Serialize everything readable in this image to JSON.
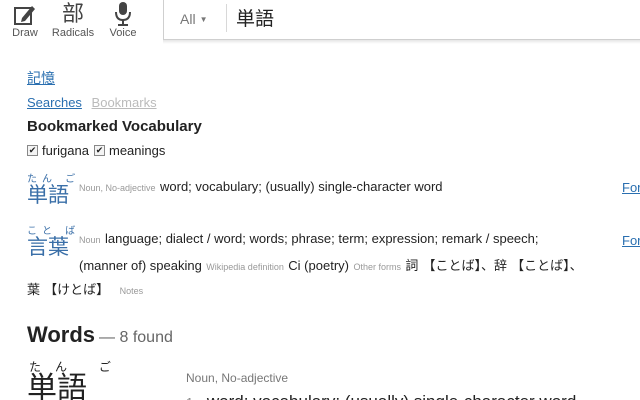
{
  "toolbar": {
    "draw_label": "Draw",
    "radicals_label": "Radicals",
    "radicals_glyph": "部",
    "voice_label": "Voice"
  },
  "search": {
    "scope": "All",
    "query": "単語"
  },
  "memory_link": "記憶",
  "tabs": {
    "searches": "Searches",
    "bookmarks": "Bookmarks"
  },
  "bookmarks": {
    "heading": "Bookmarked Vocabulary",
    "option_furigana": "furigana",
    "option_meanings": "meanings",
    "entries": [
      {
        "furigana": "たん ご",
        "word": "単語",
        "pos": "Noun, No-adjective",
        "meaning": "word; vocabulary; (usually) single-character word",
        "link": "For"
      },
      {
        "furigana": "こと ば",
        "word": "言葉",
        "pos": "Noun",
        "meaning1": "language; dialect / word; words; phrase; term; expression; remark / speech;",
        "meaning2": "(manner of) speaking",
        "wiki_label": "Wikipedia definition",
        "wiki_text": "Ci (poetry)",
        "other_forms_label": "Other forms",
        "other_forms": "詞 【ことば】、辞 【ことば】、",
        "other_forms_cont": "葉 【けとば】",
        "notes_label": "Notes",
        "link": "For"
      }
    ]
  },
  "results": {
    "heading": "Words",
    "count": "— 8 found",
    "items": [
      {
        "furigana": "たん ご",
        "word": "単語",
        "pos": "Noun, No-adjective",
        "num": "1.",
        "definition": "word; vocabulary; (usually) single-character word"
      }
    ]
  }
}
